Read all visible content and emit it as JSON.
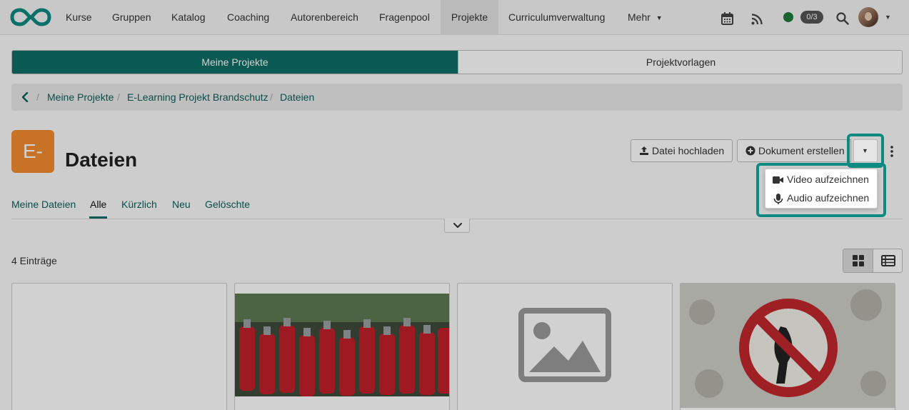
{
  "nav": {
    "items": [
      {
        "label": "Kurse"
      },
      {
        "label": "Gruppen"
      },
      {
        "label": "Katalog"
      },
      {
        "label": "Coaching"
      },
      {
        "label": "Autorenbereich"
      },
      {
        "label": "Fragenpool"
      },
      {
        "label": "Projekte",
        "active": true
      },
      {
        "label": "Curriculumverwaltung"
      },
      {
        "label": "Mehr"
      }
    ],
    "status_badge": "0/3",
    "icons": [
      "calendar-icon",
      "rss-icon",
      "online-status-dot",
      "search-icon",
      "avatar",
      "chevron-down-icon"
    ]
  },
  "segment": {
    "active": "Meine Projekte",
    "inactive": "Projektvorlagen"
  },
  "breadcrumb": {
    "items": [
      "Meine Projekte",
      "E-Learning Projekt Brandschutz",
      "Dateien"
    ]
  },
  "header": {
    "project_icon_text": "E-",
    "title": "Dateien",
    "upload_label": "Datei hochladen",
    "create_label": "Dokument erstellen"
  },
  "dropdown": {
    "items": [
      "Video aufzeichnen",
      "Audio aufzeichnen"
    ]
  },
  "tabs": {
    "items": [
      "Meine Dateien",
      "Alle",
      "Kürzlich",
      "Neu",
      "Gelöschte"
    ],
    "active": "Alle"
  },
  "list": {
    "count_label": "4 Einträge"
  },
  "colors": {
    "brand": "#0d6d66",
    "highlight": "#0d8a82",
    "project_icon": "#f58b2e"
  }
}
